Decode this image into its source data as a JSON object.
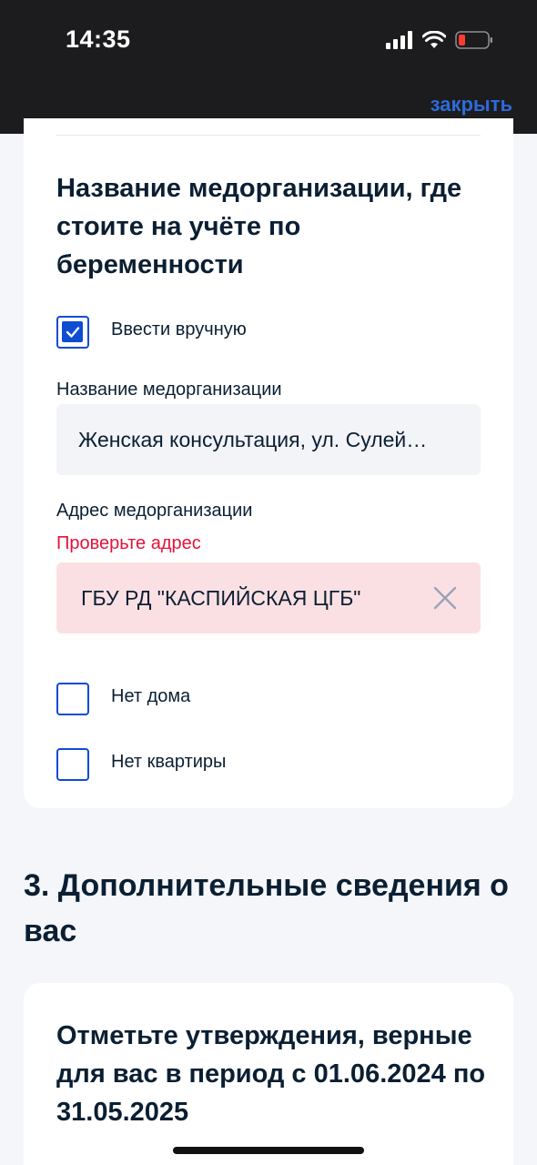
{
  "status_bar": {
    "time": "14:35"
  },
  "header": {
    "close_label": "закрыть"
  },
  "org_section": {
    "title": "Название медорганизации, где стоите на учёте по беременности",
    "manual_checkbox": {
      "label": "Ввести вручную",
      "checked": true
    },
    "name_field": {
      "label": "Название медорганизации",
      "value": "Женская консультация, ул. Сулей…"
    },
    "address_field": {
      "label": "Адрес медорганизации",
      "error": "Проверьте адрес",
      "value": "ГБУ РД \"КАСПИЙСКАЯ ЦГБ\""
    },
    "no_house_checkbox": {
      "label": "Нет дома",
      "checked": false
    },
    "no_flat_checkbox": {
      "label": "Нет квартиры",
      "checked": false
    }
  },
  "extra_section": {
    "heading": "3. Дополнительные сведения о вас",
    "card_title": "Отметьте утверждения, верные для вас в период с 01.06.2024 по 31.05.2025"
  },
  "colors": {
    "accent": "#0d4cd3",
    "link": "#2d6bd8",
    "error": "#e3133a",
    "error_bg": "#fbe0e3",
    "input_bg": "#f2f4f7",
    "topbar": "#1c1c1e"
  }
}
